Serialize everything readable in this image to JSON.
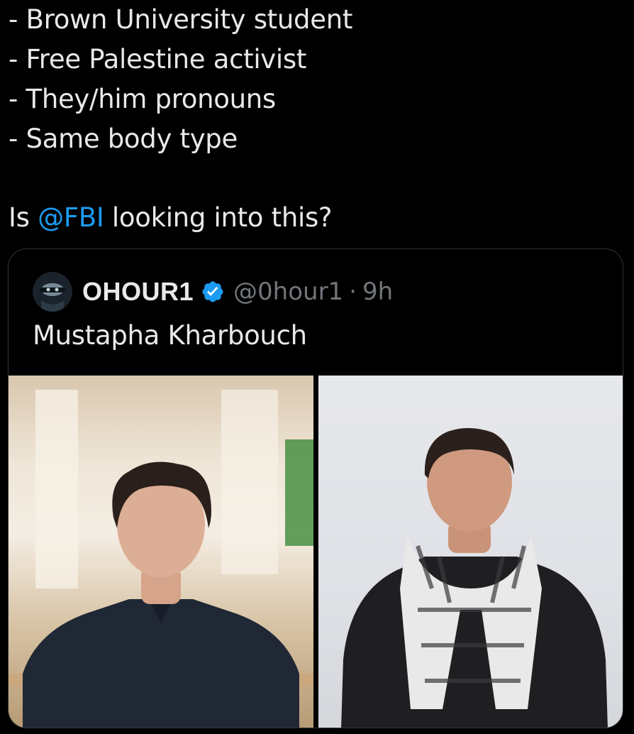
{
  "tweet": {
    "lines": [
      "- Brown University student",
      "- Free Palestine activist",
      "- They/him pronouns",
      "- Same body type"
    ],
    "question_prefix": "Is ",
    "mention": "@FBI",
    "question_suffix": " looking into this?"
  },
  "quote": {
    "display_name": "OHOUR1",
    "handle": "@0hour1",
    "separator": "·",
    "time": "9h",
    "text": "Mustapha Kharbouch",
    "verified_icon": "verified-badge-icon",
    "avatar_icon": "avatar-image"
  },
  "media": {
    "photos": [
      {
        "name": "left-photo"
      },
      {
        "name": "right-photo"
      }
    ]
  },
  "colors": {
    "background": "#000000",
    "text": "#e7e9ea",
    "mention": "#1d9bf0",
    "secondary": "#71767b",
    "border": "#2f3336",
    "verified": "#1d9bf0"
  }
}
